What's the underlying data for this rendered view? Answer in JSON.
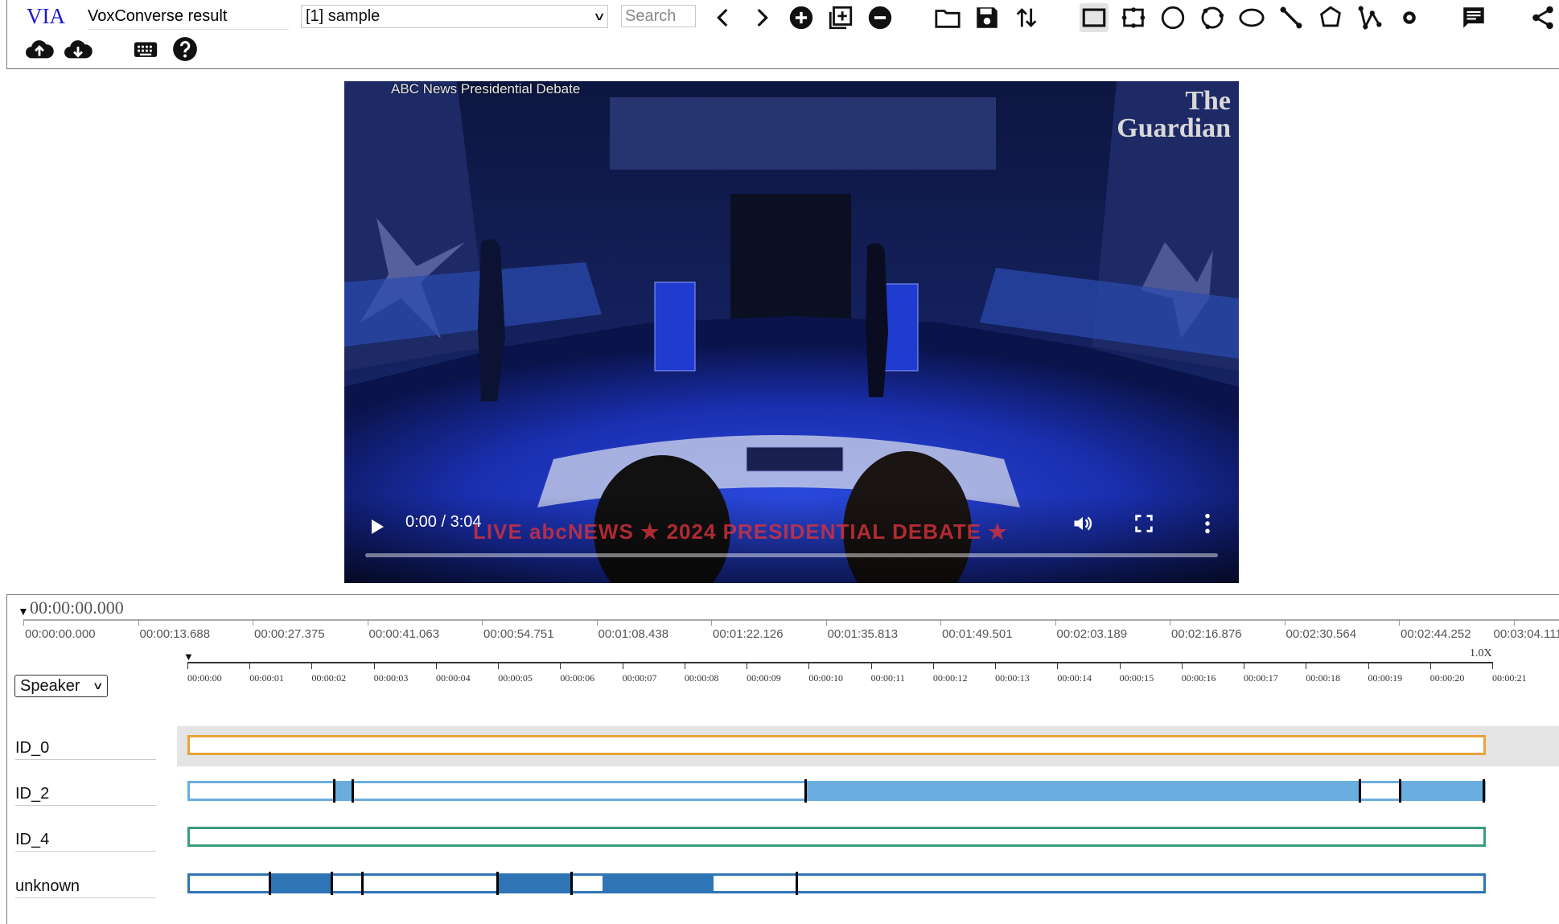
{
  "app": {
    "logo": "VIA",
    "project_name": "VoxConverse result",
    "file_selector": "[1] sample",
    "search_placeholder": "Search"
  },
  "toolbar": {
    "icons": [
      "prev-icon",
      "next-icon",
      "add-file-icon",
      "add-region-icon",
      "remove-icon",
      "open-folder-icon",
      "save-icon",
      "import-export-icon",
      "rectangle-shape-icon",
      "extreme-rect-icon",
      "circle-shape-icon",
      "extreme-circle-icon",
      "ellipse-shape-icon",
      "line-shape-icon",
      "polygon-shape-icon",
      "polyline-shape-icon",
      "point-shape-icon",
      "comment-icon",
      "share-icon",
      "upload-icon",
      "download-icon",
      "keyboard-icon",
      "help-icon"
    ]
  },
  "video": {
    "caption": "ABC News Presidential Debate",
    "watermark_line1": "The",
    "watermark_line2": "Guardian",
    "ticker": "LIVE  abcNEWS  ★ 2024 PRESIDENTIAL DEBATE ★",
    "time": "0:00 / 3:04",
    "progress": 0
  },
  "timeline": {
    "current_time": "00:00:00.000",
    "ruler_labels": [
      "00:00:00.000",
      "00:00:13.688",
      "00:00:27.375",
      "00:00:41.063",
      "00:00:54.751",
      "00:01:08.438",
      "00:01:22.126",
      "00:01:35.813",
      "00:01:49.501",
      "00:02:03.189",
      "00:02:16.876",
      "00:02:30.564",
      "00:02:44.252",
      "00:03:04.111"
    ],
    "zoom_labels": [
      "00:00:00",
      "00:00:01",
      "00:00:02",
      "00:00:03",
      "00:00:04",
      "00:00:05",
      "00:00:06",
      "00:00:07",
      "00:00:08",
      "00:00:09",
      "00:00:10",
      "00:00:11",
      "00:00:12",
      "00:00:13",
      "00:00:14",
      "00:00:15",
      "00:00:16",
      "00:00:17",
      "00:00:18",
      "00:00:19",
      "00:00:20",
      "00:00:21"
    ],
    "zoom_level": "1.0X",
    "group_by": "Speaker",
    "visible_window_seconds": 21,
    "tracks": [
      {
        "label": "ID_0",
        "color": "#e8a33a",
        "selected": true,
        "segments": []
      },
      {
        "label": "ID_2",
        "color": "#6aaee0",
        "selected": false,
        "segments": [
          [
            2.34,
            2.64
          ],
          [
            10.0,
            19.0
          ],
          [
            19.65,
            21.0
          ]
        ],
        "edges": [
          2.34,
          2.64,
          10.0,
          19.0,
          19.65,
          21.0
        ]
      },
      {
        "label": "ID_4",
        "color": "#3b9c7c",
        "selected": false,
        "segments": []
      },
      {
        "label": "unknown",
        "color": "#2f75b5",
        "selected": false,
        "segments": [
          [
            1.3,
            2.3
          ],
          [
            5.0,
            6.2
          ],
          [
            6.7,
            8.5
          ]
        ],
        "edges": [
          1.3,
          2.3,
          2.8,
          5.0,
          6.2,
          9.85
        ]
      }
    ]
  }
}
